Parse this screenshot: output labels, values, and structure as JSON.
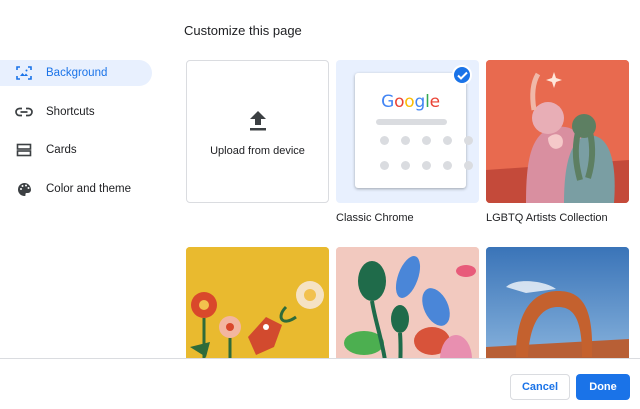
{
  "dialog": {
    "title": "Customize this page"
  },
  "sidebar": {
    "items": [
      {
        "label": "Background",
        "icon": "background-icon",
        "selected": true
      },
      {
        "label": "Shortcuts",
        "icon": "link-icon",
        "selected": false
      },
      {
        "label": "Cards",
        "icon": "cards-icon",
        "selected": false
      },
      {
        "label": "Color and theme",
        "icon": "palette-icon",
        "selected": false
      }
    ]
  },
  "backgrounds": {
    "upload_label": "Upload from device",
    "classic": {
      "caption": "Classic Chrome",
      "logo": "Google",
      "selected": true
    },
    "lgbtq": {
      "caption": "LGBTQ Artists Collection"
    }
  },
  "footer": {
    "cancel_label": "Cancel",
    "done_label": "Done"
  },
  "colors": {
    "accent": "#1a73e8",
    "selected_bg": "#e8f0fe",
    "divider": "#dadce0"
  }
}
